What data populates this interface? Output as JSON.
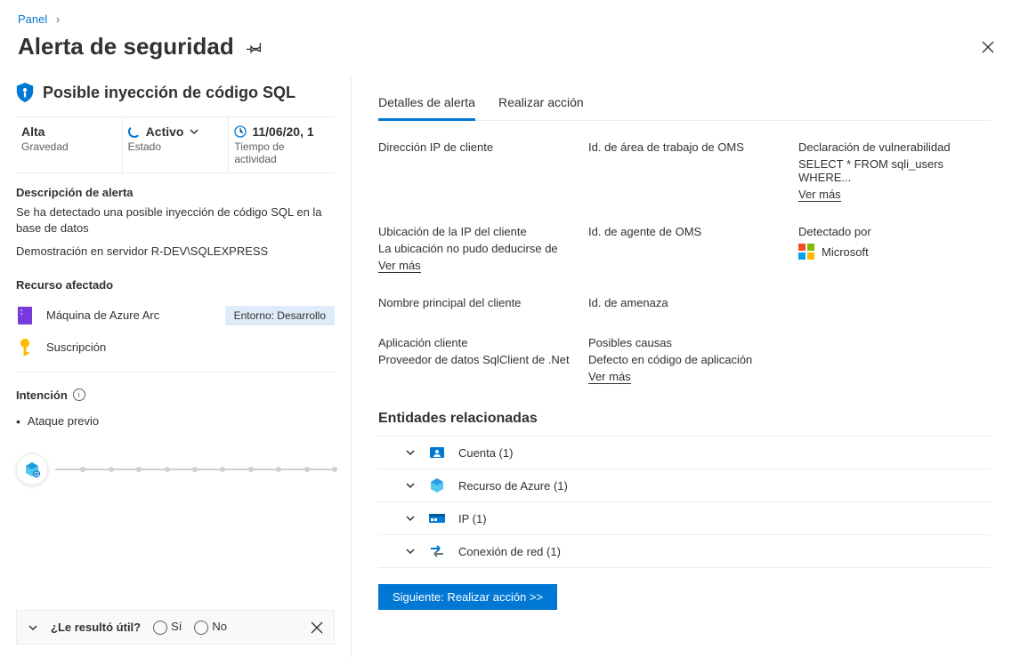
{
  "breadcrumb": {
    "root": "Panel"
  },
  "page_title": "Alerta de seguridad",
  "alert": {
    "name": "Posible inyección de código SQL",
    "severity": {
      "value": "Alta",
      "label": "Gravedad"
    },
    "status": {
      "value": "Activo",
      "label": "Estado"
    },
    "uptime": {
      "value": "11/06/20, 1",
      "label": "Tiempo de actividad"
    }
  },
  "description": {
    "heading": "Descripción de alerta",
    "body": "Se ha detectado una posible inyección de código SQL en la base de datos",
    "demo": "Demostración en servidor R-DEV\\SQLEXPRESS"
  },
  "affected": {
    "heading": "Recurso afectado",
    "items": [
      {
        "icon": "server-icon",
        "label": "Máquina de Azure Arc",
        "tag": "Entorno: Desarrollo"
      },
      {
        "icon": "key-icon",
        "label": "Suscripción",
        "tag": null
      }
    ]
  },
  "intent": {
    "heading": "Intención",
    "item": "Ataque previo"
  },
  "feedback": {
    "question": "¿Le resultó útil?",
    "yes": "Sí",
    "no": "No"
  },
  "tabs": {
    "details": "Detalles de alerta",
    "action": "Realizar acción"
  },
  "details": {
    "client_ip": {
      "label": "Dirección IP de cliente"
    },
    "oms_workspace": {
      "label": "Id. de área de trabajo de OMS"
    },
    "vuln": {
      "label": "Declaración de vulnerabilidad",
      "value": "SELECT * FROM sqli_users WHERE...",
      "more": "Ver más"
    },
    "client_ip_loc": {
      "label": "Ubicación de la IP del cliente",
      "value": "La ubicación no pudo deducirse de",
      "more": "Ver más"
    },
    "oms_agent": {
      "label": "Id. de agente de OMS"
    },
    "detected_by": {
      "label": "Detectado por",
      "value": "Microsoft"
    },
    "client_principal": {
      "label": "Nombre principal del cliente"
    },
    "threat_id": {
      "label": "Id. de amenaza"
    },
    "client_app": {
      "label": "Aplicación cliente",
      "value": "Proveedor de datos SqlClient de .Net"
    },
    "causes": {
      "label": "Posibles causas",
      "value": "Defecto en código de aplicación",
      "more": "Ver más"
    }
  },
  "entities": {
    "heading": "Entidades relacionadas",
    "rows": [
      {
        "label": "Cuenta (1)"
      },
      {
        "label": "Recurso de Azure (1)"
      },
      {
        "label": "IP (1)"
      },
      {
        "label": "Conexión de red (1)"
      }
    ]
  },
  "next_button": "Siguiente: Realizar acción >>"
}
